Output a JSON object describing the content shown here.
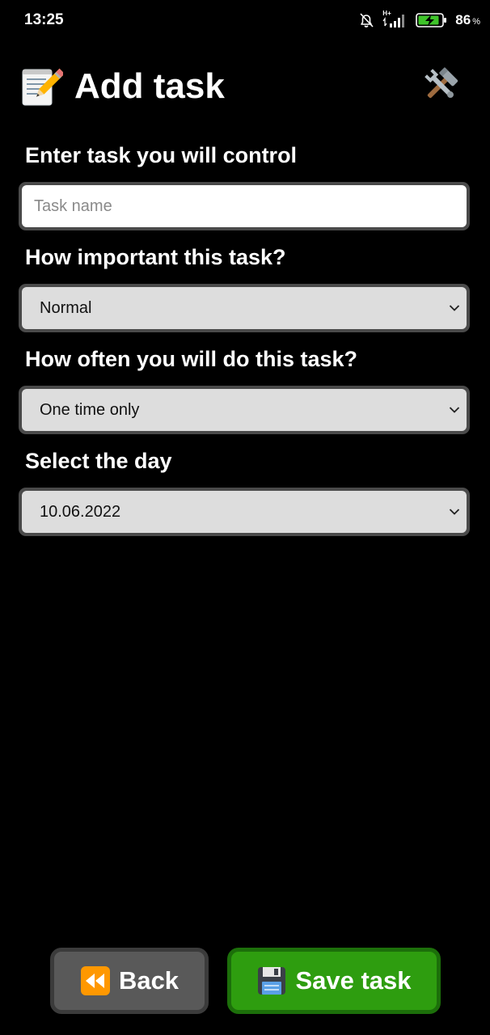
{
  "status_bar": {
    "time": "13:25",
    "network": "H+",
    "battery_percent": "86",
    "battery_unit": "%"
  },
  "header": {
    "title": "Add task",
    "icon": "memo-pencil-icon",
    "settings_icon": "hammer-wrench-icon"
  },
  "form": {
    "task_label": "Enter task you will control",
    "task_input": {
      "value": "",
      "placeholder": "Task name"
    },
    "importance_label": "How important this task?",
    "importance_value": "Normal",
    "frequency_label": "How often you will do this task?",
    "frequency_value": "One time only",
    "day_label": "Select the day",
    "day_value": "10.06.2022"
  },
  "buttons": {
    "back_label": "Back",
    "back_icon": "rewind-icon",
    "save_label": "Save task",
    "save_icon": "floppy-disk-icon"
  },
  "colors": {
    "background": "#000000",
    "save_button": "#2e9d0f",
    "back_button": "#595959",
    "select_background": "#dddddd"
  }
}
